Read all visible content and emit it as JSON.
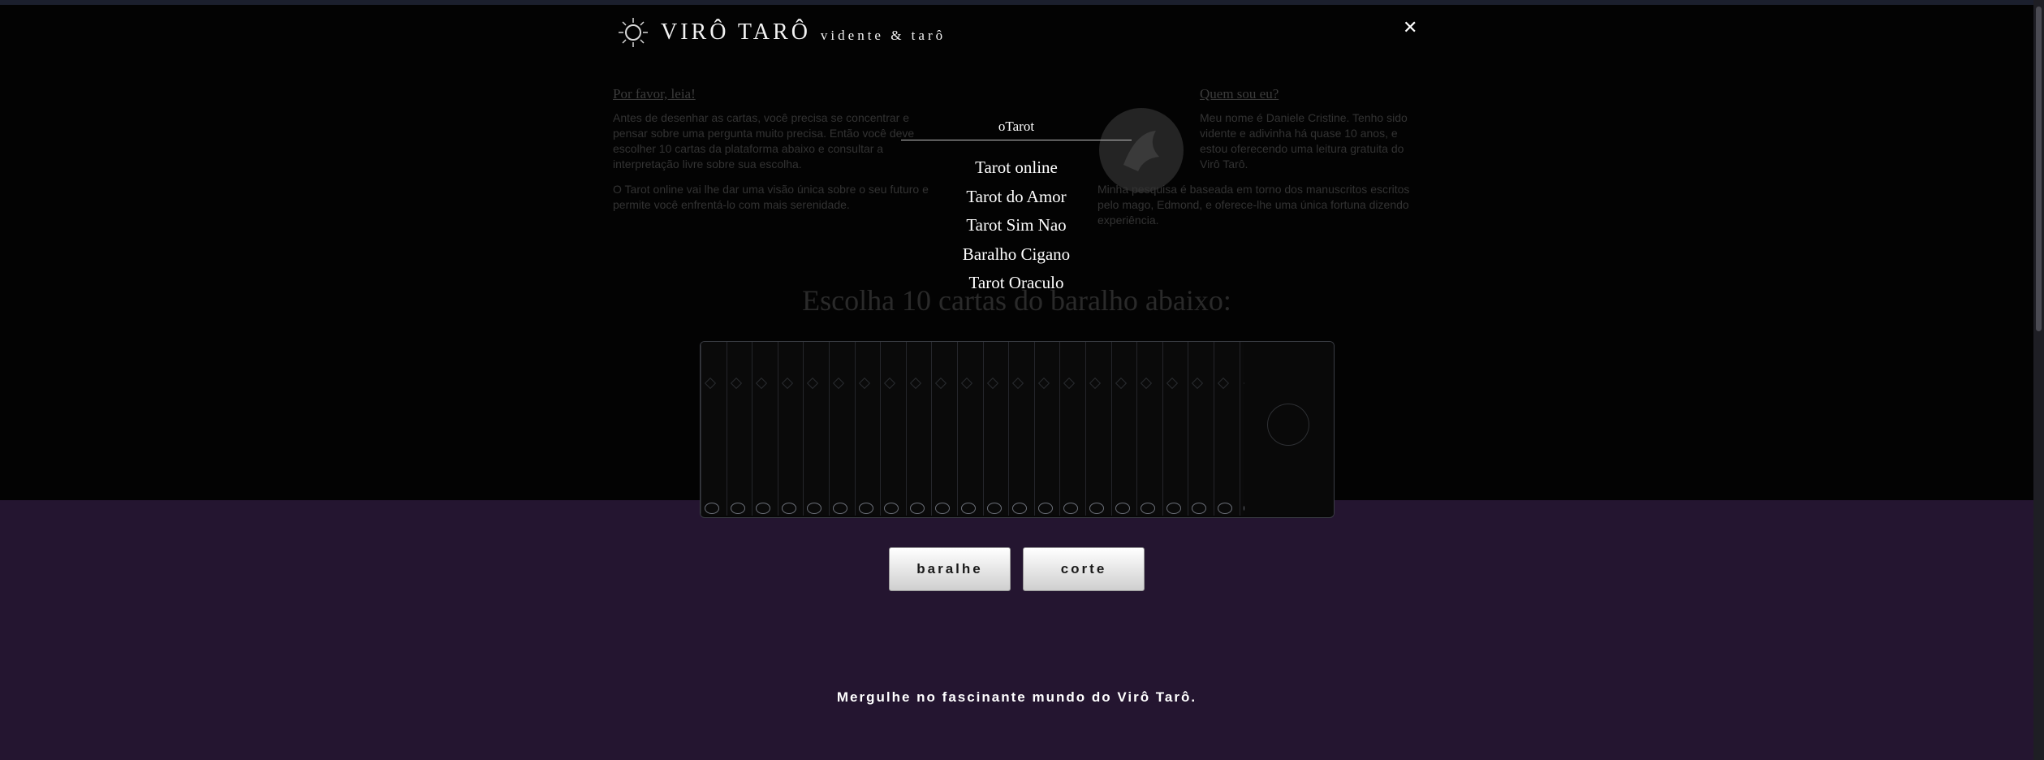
{
  "header": {
    "brand_name": "VIRÔ TARÔ",
    "brand_tagline": "vidente & tarô",
    "close_label": "✕"
  },
  "intro": {
    "left_heading": "Por favor, leia!",
    "left_paragraph_1": "Antes de desenhar as cartas, você precisa se concentrar e pensar sobre uma pergunta muito precisa. Então você deve escolher 10 cartas da plataforma abaixo e consultar a interpretação livre sobre sua escolha.",
    "left_paragraph_2": "O Tarot online vai lhe dar uma visão única sobre o seu futuro e permite você enfrentá-lo com mais serenidade.",
    "right_heading": "Quem sou eu?",
    "right_paragraph_1": "Meu nome é Daniele Cristine. Tenho sido vidente e adivinha há quase 10 anos, e estou oferecendo uma leitura gratuita do Virô Tarô.",
    "right_paragraph_2": "Minha pesquisa é baseada em torno dos manuscritos escritos pelo mago, Edmond, e oferece-lhe uma única fortuna dizendo experiência."
  },
  "choose_heading": "Escolha 10 cartas do baralho abaixo:",
  "menu": {
    "title": "oTarot",
    "items": [
      "Tarot online",
      "Tarot do Amor",
      "Tarot Sim Nao",
      "Baralho Cigano",
      "Tarot Oraculo"
    ]
  },
  "buttons": {
    "deck_label": "baralhe",
    "cut_label": "corte"
  },
  "footer_text": "Mergulhe no fascinante mundo do Virô Tarô.",
  "colors": {
    "page_background": "#241530",
    "overlay_background": "#030303",
    "text_white": "#ffffff"
  }
}
